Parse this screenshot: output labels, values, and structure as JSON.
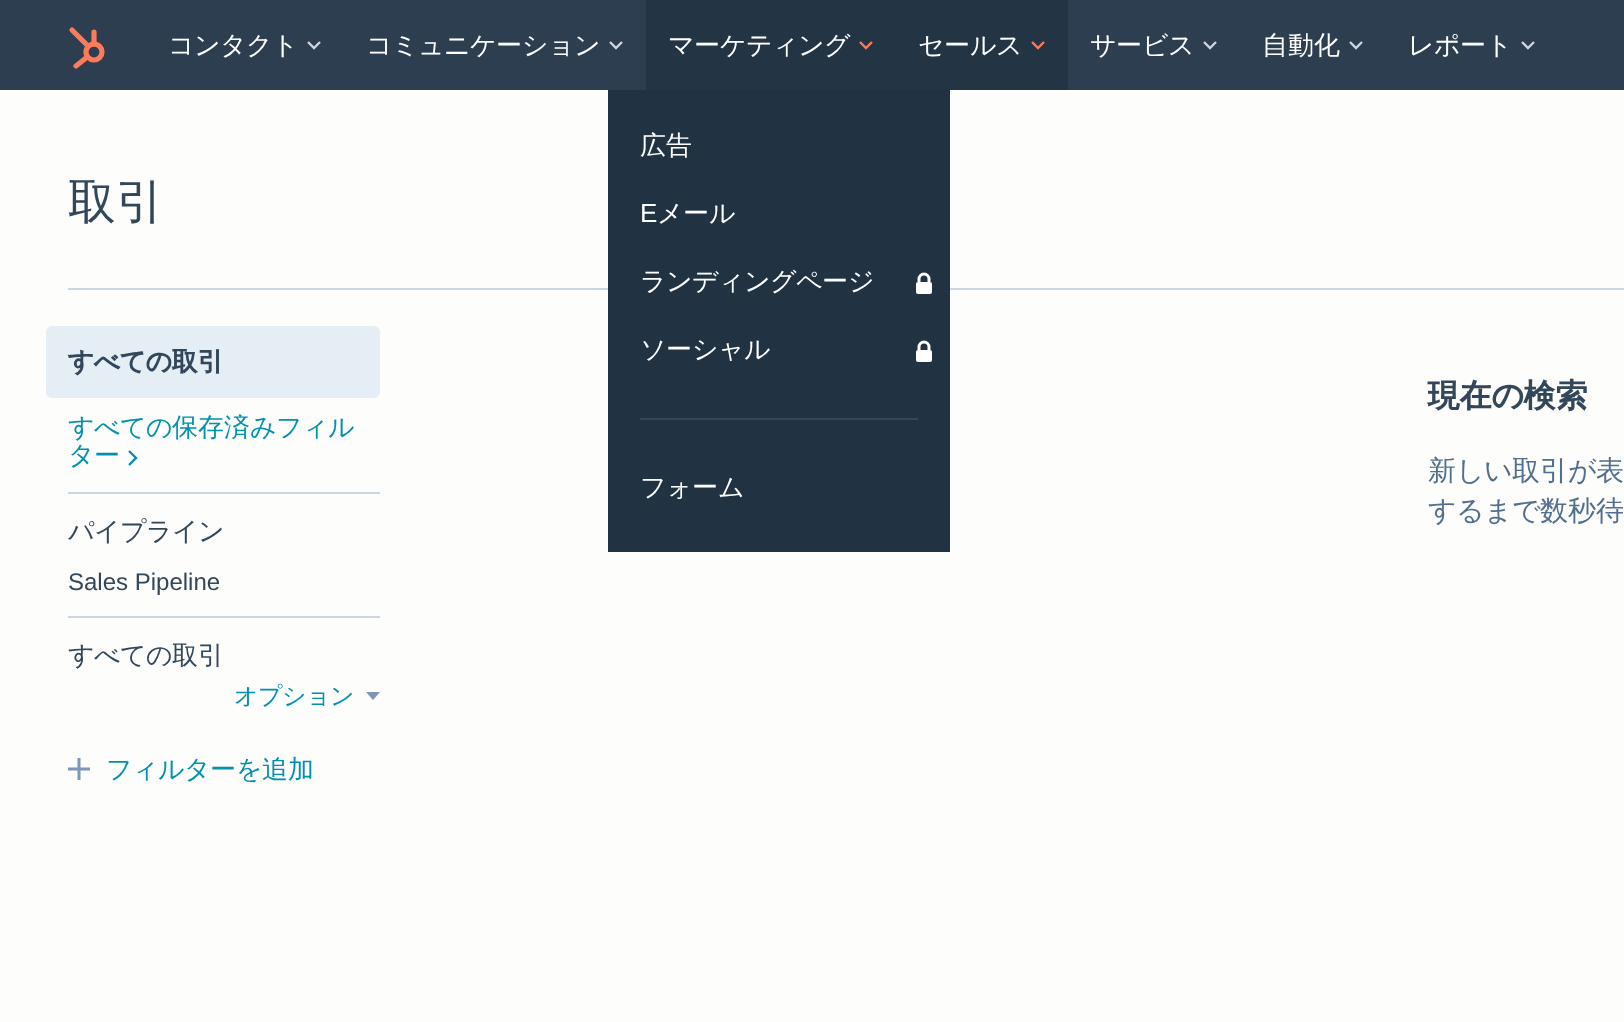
{
  "nav": {
    "items": [
      {
        "label": "コンタクト",
        "active": false
      },
      {
        "label": "コミュニケーション",
        "active": false
      },
      {
        "label": "マーケティング",
        "active": true
      },
      {
        "label": "セールス",
        "active": true
      },
      {
        "label": "サービス",
        "active": false
      },
      {
        "label": "自動化",
        "active": false
      },
      {
        "label": "レポート",
        "active": false
      }
    ]
  },
  "dropdown": {
    "items": [
      {
        "kind": "item",
        "label": "広告",
        "locked": false
      },
      {
        "kind": "item",
        "label": "Eメール",
        "locked": false
      },
      {
        "kind": "item",
        "label": "ランディングページ",
        "locked": true
      },
      {
        "kind": "item",
        "label": "ソーシャル",
        "locked": true
      },
      {
        "kind": "divider"
      },
      {
        "kind": "item",
        "label": "フォーム",
        "locked": false
      }
    ]
  },
  "page": {
    "title": "取引"
  },
  "sidebar": {
    "views": [
      {
        "label": "すべての取引",
        "selected": true
      }
    ],
    "saved_filters_link": "すべての保存済みフィルター",
    "pipeline": {
      "label": "パイプライン",
      "value": "Sales Pipeline"
    },
    "filter": {
      "label": "すべての取引",
      "options": "オプション"
    },
    "add_filter": "フィルターを追加"
  },
  "empty_state": {
    "title": "現在の検索",
    "lines": [
      "新しい取引が表",
      "するまで数秒待"
    ]
  }
}
